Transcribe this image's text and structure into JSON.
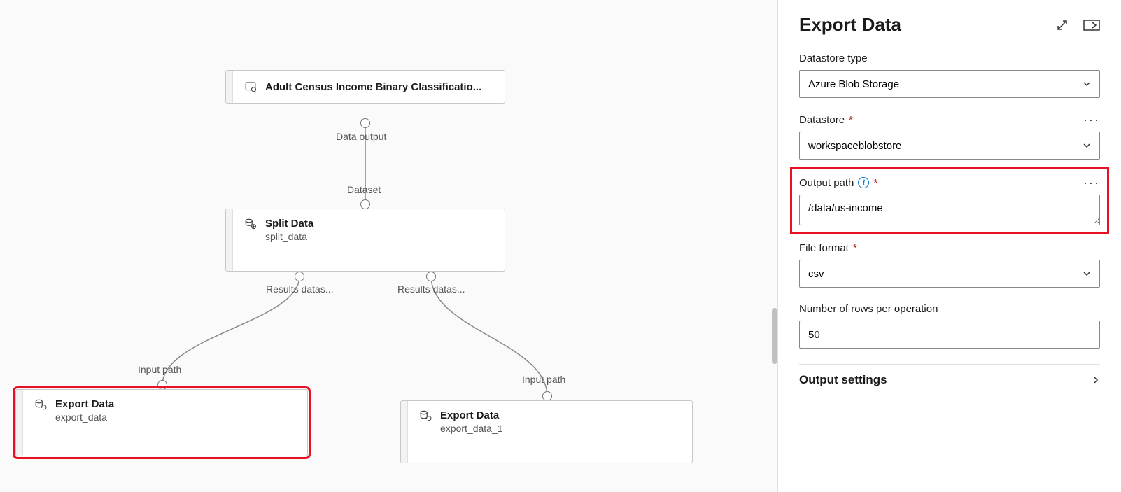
{
  "panel": {
    "title": "Export Data",
    "datastore_type_label": "Datastore type",
    "datastore_type_value": "Azure Blob Storage",
    "datastore_label": "Datastore",
    "datastore_value": "workspaceblobstore",
    "output_path_label": "Output path",
    "output_path_value": "/data/us-income",
    "file_format_label": "File format",
    "file_format_value": "csv",
    "rows_label": "Number of rows per operation",
    "rows_value": "50",
    "section_output_settings": "Output settings"
  },
  "nodes": {
    "dataset": {
      "title": "Adult Census Income Binary Classificatio...",
      "port_out": "Data output"
    },
    "split": {
      "title": "Split Data",
      "subtitle": "split_data",
      "port_in": "Dataset",
      "port_out1": "Results datas...",
      "port_out2": "Results datas..."
    },
    "export1": {
      "title": "Export Data",
      "subtitle": "export_data",
      "port_in": "Input path"
    },
    "export2": {
      "title": "Export Data",
      "subtitle": "export_data_1",
      "port_in": "Input path"
    }
  }
}
